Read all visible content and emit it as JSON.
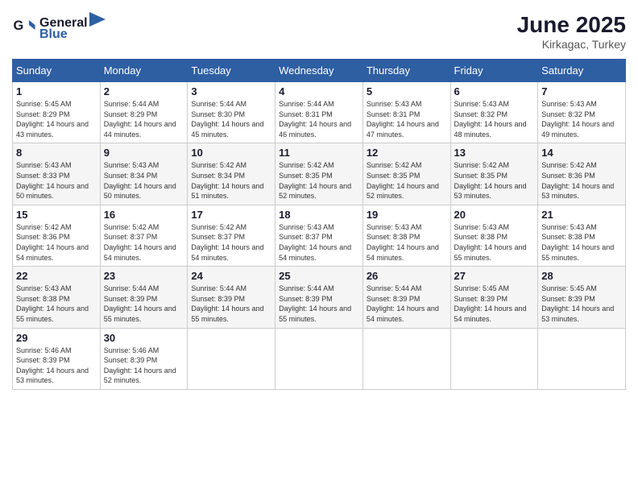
{
  "header": {
    "logo_line1": "General",
    "logo_line2": "Blue",
    "month": "June 2025",
    "location": "Kirkagac, Turkey"
  },
  "weekdays": [
    "Sunday",
    "Monday",
    "Tuesday",
    "Wednesday",
    "Thursday",
    "Friday",
    "Saturday"
  ],
  "weeks": [
    [
      {
        "day": "1",
        "sunrise": "5:45 AM",
        "sunset": "8:29 PM",
        "daylight": "14 hours and 43 minutes."
      },
      {
        "day": "2",
        "sunrise": "5:44 AM",
        "sunset": "8:29 PM",
        "daylight": "14 hours and 44 minutes."
      },
      {
        "day": "3",
        "sunrise": "5:44 AM",
        "sunset": "8:30 PM",
        "daylight": "14 hours and 45 minutes."
      },
      {
        "day": "4",
        "sunrise": "5:44 AM",
        "sunset": "8:31 PM",
        "daylight": "14 hours and 46 minutes."
      },
      {
        "day": "5",
        "sunrise": "5:43 AM",
        "sunset": "8:31 PM",
        "daylight": "14 hours and 47 minutes."
      },
      {
        "day": "6",
        "sunrise": "5:43 AM",
        "sunset": "8:32 PM",
        "daylight": "14 hours and 48 minutes."
      },
      {
        "day": "7",
        "sunrise": "5:43 AM",
        "sunset": "8:32 PM",
        "daylight": "14 hours and 49 minutes."
      }
    ],
    [
      {
        "day": "8",
        "sunrise": "5:43 AM",
        "sunset": "8:33 PM",
        "daylight": "14 hours and 50 minutes."
      },
      {
        "day": "9",
        "sunrise": "5:43 AM",
        "sunset": "8:34 PM",
        "daylight": "14 hours and 50 minutes."
      },
      {
        "day": "10",
        "sunrise": "5:42 AM",
        "sunset": "8:34 PM",
        "daylight": "14 hours and 51 minutes."
      },
      {
        "day": "11",
        "sunrise": "5:42 AM",
        "sunset": "8:35 PM",
        "daylight": "14 hours and 52 minutes."
      },
      {
        "day": "12",
        "sunrise": "5:42 AM",
        "sunset": "8:35 PM",
        "daylight": "14 hours and 52 minutes."
      },
      {
        "day": "13",
        "sunrise": "5:42 AM",
        "sunset": "8:35 PM",
        "daylight": "14 hours and 53 minutes."
      },
      {
        "day": "14",
        "sunrise": "5:42 AM",
        "sunset": "8:36 PM",
        "daylight": "14 hours and 53 minutes."
      }
    ],
    [
      {
        "day": "15",
        "sunrise": "5:42 AM",
        "sunset": "8:36 PM",
        "daylight": "14 hours and 54 minutes."
      },
      {
        "day": "16",
        "sunrise": "5:42 AM",
        "sunset": "8:37 PM",
        "daylight": "14 hours and 54 minutes."
      },
      {
        "day": "17",
        "sunrise": "5:42 AM",
        "sunset": "8:37 PM",
        "daylight": "14 hours and 54 minutes."
      },
      {
        "day": "18",
        "sunrise": "5:43 AM",
        "sunset": "8:37 PM",
        "daylight": "14 hours and 54 minutes."
      },
      {
        "day": "19",
        "sunrise": "5:43 AM",
        "sunset": "8:38 PM",
        "daylight": "14 hours and 54 minutes."
      },
      {
        "day": "20",
        "sunrise": "5:43 AM",
        "sunset": "8:38 PM",
        "daylight": "14 hours and 55 minutes."
      },
      {
        "day": "21",
        "sunrise": "5:43 AM",
        "sunset": "8:38 PM",
        "daylight": "14 hours and 55 minutes."
      }
    ],
    [
      {
        "day": "22",
        "sunrise": "5:43 AM",
        "sunset": "8:38 PM",
        "daylight": "14 hours and 55 minutes."
      },
      {
        "day": "23",
        "sunrise": "5:44 AM",
        "sunset": "8:39 PM",
        "daylight": "14 hours and 55 minutes."
      },
      {
        "day": "24",
        "sunrise": "5:44 AM",
        "sunset": "8:39 PM",
        "daylight": "14 hours and 55 minutes."
      },
      {
        "day": "25",
        "sunrise": "5:44 AM",
        "sunset": "8:39 PM",
        "daylight": "14 hours and 55 minutes."
      },
      {
        "day": "26",
        "sunrise": "5:44 AM",
        "sunset": "8:39 PM",
        "daylight": "14 hours and 54 minutes."
      },
      {
        "day": "27",
        "sunrise": "5:45 AM",
        "sunset": "8:39 PM",
        "daylight": "14 hours and 54 minutes."
      },
      {
        "day": "28",
        "sunrise": "5:45 AM",
        "sunset": "8:39 PM",
        "daylight": "14 hours and 53 minutes."
      }
    ],
    [
      {
        "day": "29",
        "sunrise": "5:46 AM",
        "sunset": "8:39 PM",
        "daylight": "14 hours and 53 minutes."
      },
      {
        "day": "30",
        "sunrise": "5:46 AM",
        "sunset": "8:39 PM",
        "daylight": "14 hours and 52 minutes."
      },
      null,
      null,
      null,
      null,
      null
    ]
  ]
}
